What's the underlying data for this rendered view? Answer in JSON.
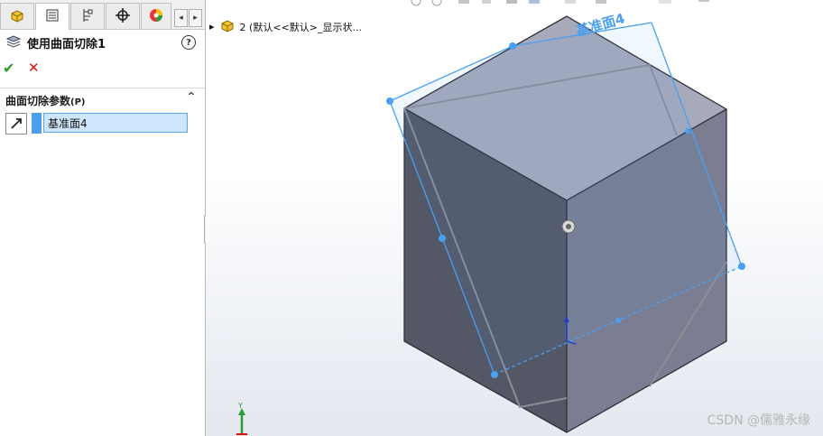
{
  "feature": {
    "title": "使用曲面切除1",
    "section_title": "曲面切除参数",
    "section_hotkey": "(P)",
    "selected_face": "基准面4"
  },
  "breadcrumb": {
    "arrow": "▸",
    "text": "2 (默认<<默认>_显示状..."
  },
  "viewport": {
    "plane_label": "基准面4",
    "axis_label": "Y"
  },
  "watermark": "CSDN @儒雅永缘",
  "colors": {
    "plane_blue": "#4a9ff0",
    "cube_top": "#a7aabb",
    "cube_left": "#545765",
    "cube_right": "#7b7e92"
  },
  "icons": [
    "part-icon",
    "feature-tree-icon",
    "property-manager-icon",
    "config-icon",
    "crosshair-icon",
    "appearance-icon",
    "help-icon",
    "surface-cut-icon",
    "face-select-icon"
  ]
}
